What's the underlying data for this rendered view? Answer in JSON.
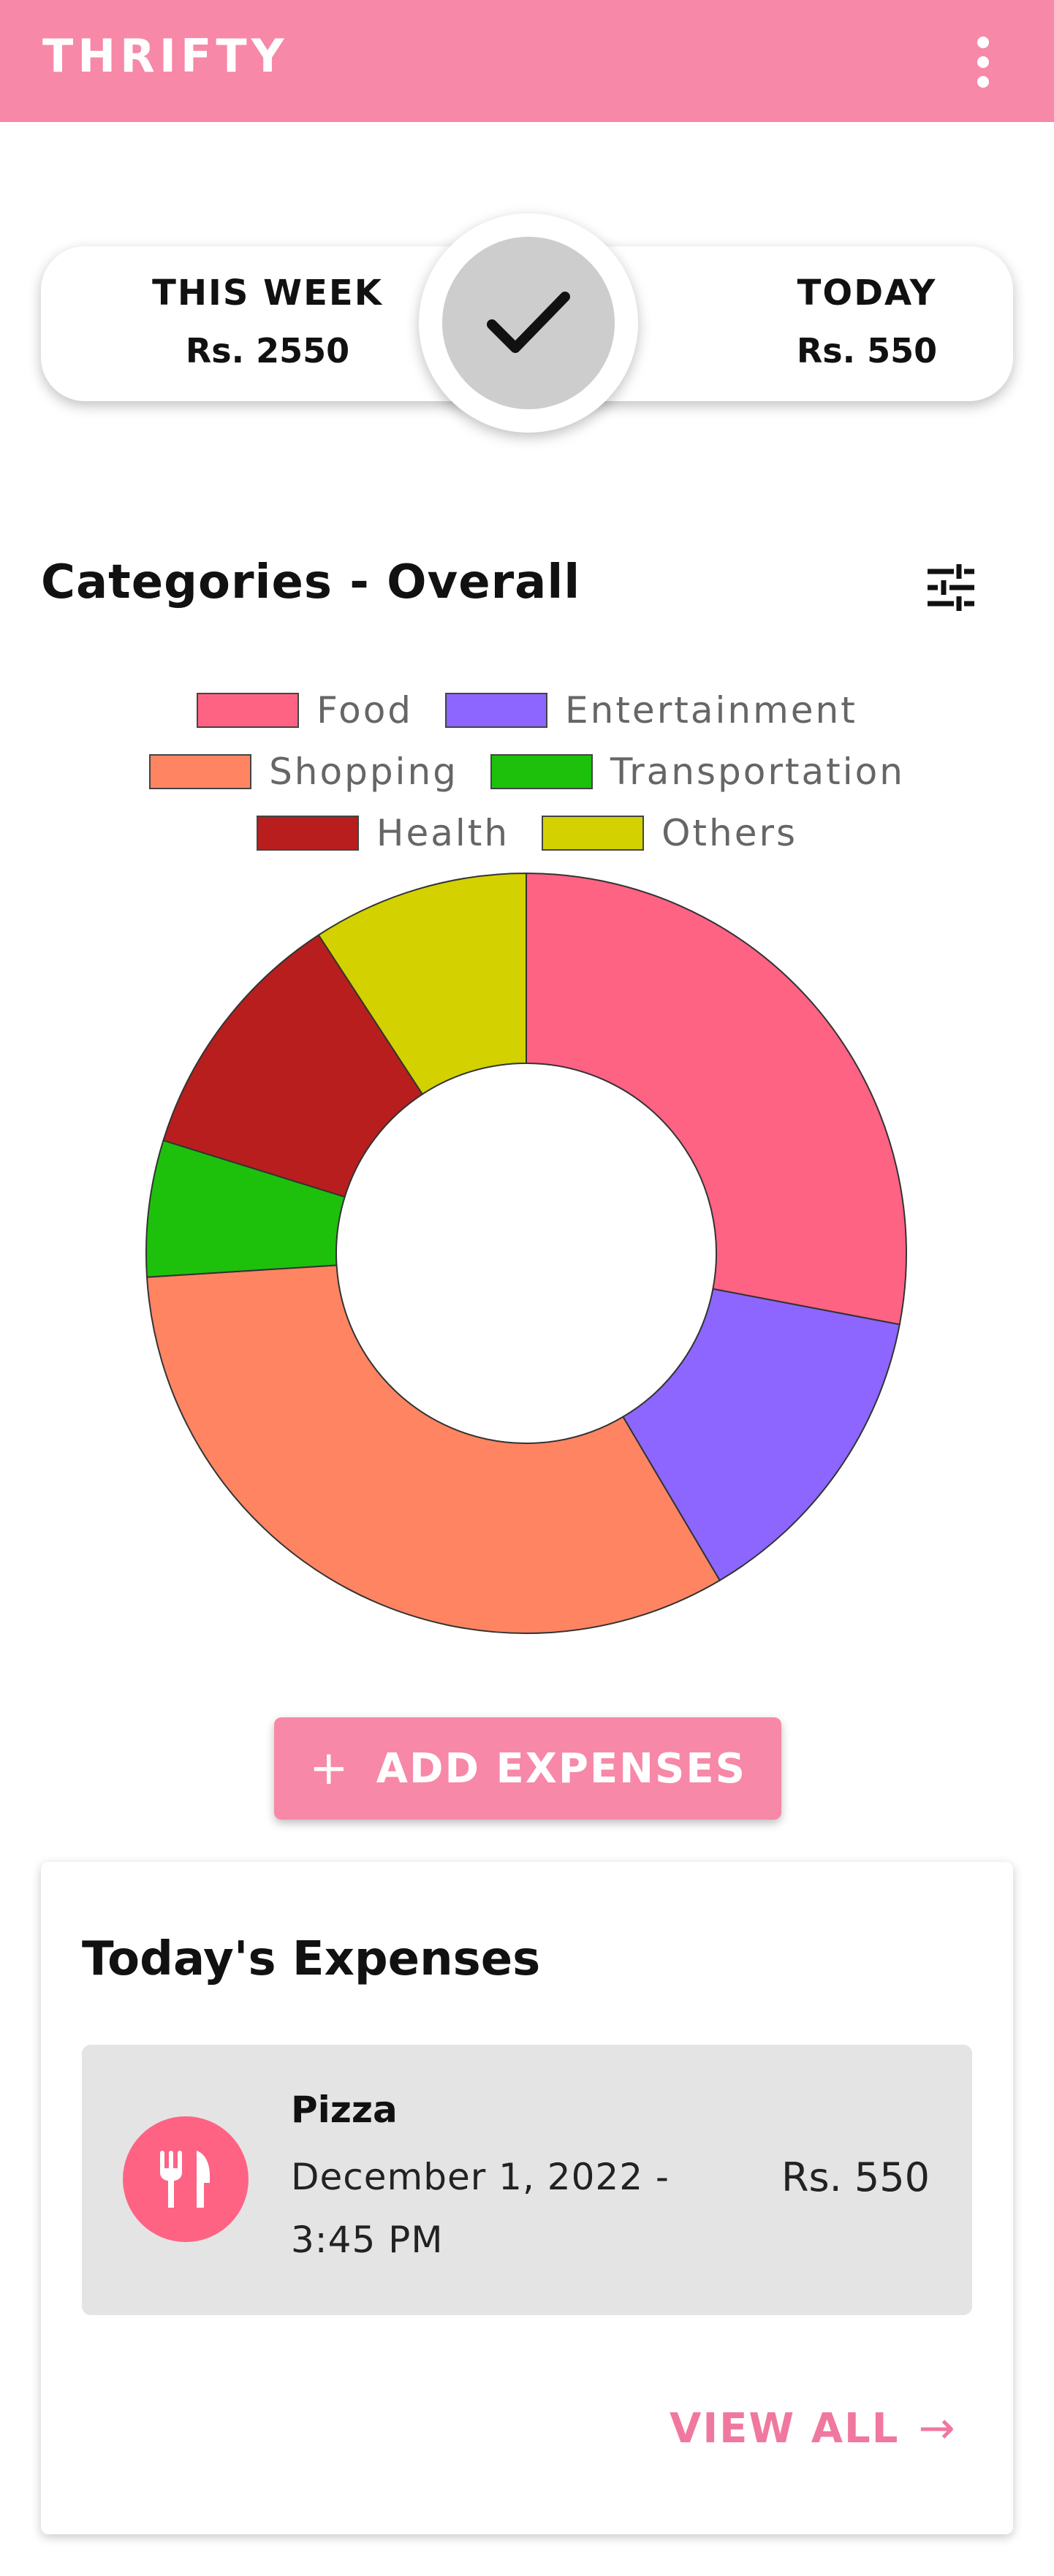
{
  "app_bar": {
    "title": "THRIFTY",
    "menu_icon": "more-vert-icon",
    "color": "#F788A7"
  },
  "summary": {
    "week_label": "THIS WEEK",
    "week_value": "Rs. 2550",
    "today_label": "TODAY",
    "today_value": "Rs. 550",
    "center_icon": "check-icon"
  },
  "categories": {
    "title": "Categories - Overall",
    "filter_icon": "tune-icon"
  },
  "chart_data": {
    "type": "pie",
    "variant": "doughnut",
    "legend_position": "top",
    "slices": [
      {
        "label": "Food",
        "color": "#FF6384",
        "value": 28.0
      },
      {
        "label": "Entertainment",
        "color": "#8C66FF",
        "value": 13.5
      },
      {
        "label": "Shopping",
        "color": "#FF8562",
        "value": 32.5
      },
      {
        "label": "Transportation",
        "color": "#1DC10C",
        "value": 5.8
      },
      {
        "label": "Health",
        "color": "#B81E1E",
        "value": 11.0
      },
      {
        "label": "Others",
        "color": "#D3D100",
        "value": 9.2
      }
    ]
  },
  "add_button": {
    "label": "ADD EXPENSES",
    "icon": "plus-icon"
  },
  "todays_expenses": {
    "title": "Today's Expenses",
    "items": [
      {
        "name": "Pizza",
        "date": "December 1, 2022 - 3:45 PM",
        "amount": "Rs. 550",
        "icon": "restaurant-icon",
        "icon_color": "#FF6384"
      }
    ],
    "view_all_label": "VIEW ALL",
    "view_all_icon": "arrow-right-icon"
  }
}
